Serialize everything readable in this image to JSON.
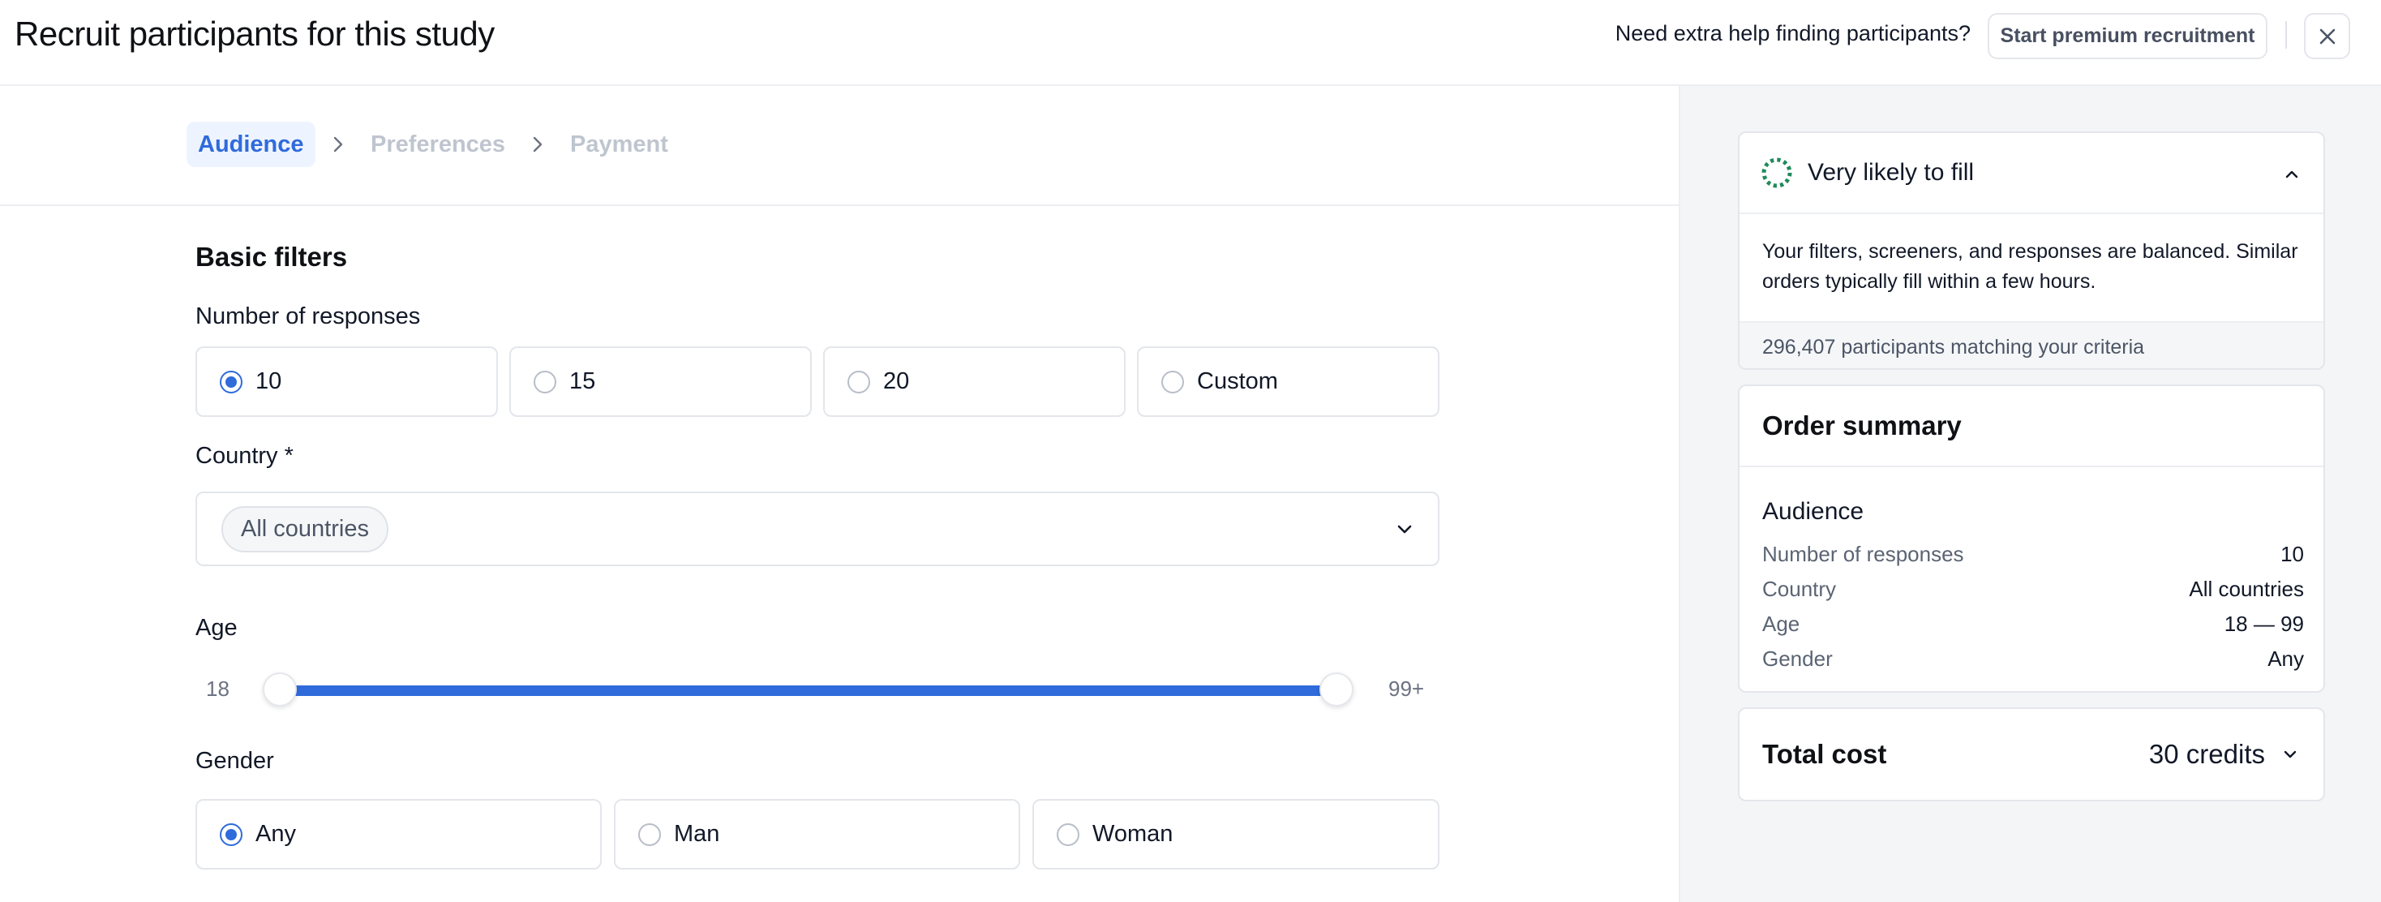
{
  "header": {
    "title": "Recruit participants for this study",
    "help_text": "Need extra help finding participants?",
    "premium_button": "Start premium recruitment"
  },
  "stepper": {
    "steps": [
      {
        "label": "Audience"
      },
      {
        "label": "Preferences"
      },
      {
        "label": "Payment"
      }
    ]
  },
  "filters": {
    "section_title": "Basic filters",
    "responses": {
      "label": "Number of responses",
      "options": [
        "10",
        "15",
        "20",
        "Custom"
      ],
      "selected": "10"
    },
    "country": {
      "label": "Country *",
      "chip": "All countries"
    },
    "age": {
      "label": "Age",
      "min_label": "18",
      "max_label": "99+",
      "range": [
        18,
        99
      ]
    },
    "gender": {
      "label": "Gender",
      "options": [
        "Any",
        "Man",
        "Woman"
      ],
      "selected": "Any"
    }
  },
  "fill_status": {
    "title": "Very likely to fill",
    "description": "Your filters, screeners, and responses are balanced. Similar orders typically fill within a few hours.",
    "match_count": "296,407 participants matching your criteria"
  },
  "summary": {
    "title": "Order summary",
    "section": "Audience",
    "rows": [
      {
        "key": "Number of responses",
        "value": "10"
      },
      {
        "key": "Country",
        "value": "All countries"
      },
      {
        "key": "Age",
        "value": "18 — 99"
      },
      {
        "key": "Gender",
        "value": "Any"
      }
    ]
  },
  "cost": {
    "title": "Total cost",
    "value": "30 credits"
  },
  "colors": {
    "accent": "#2f6bdb",
    "fill_indicator": "#1f8a5b",
    "panel_bg": "#f4f5f7"
  },
  "icons": {
    "close": "close-icon",
    "chevron_right": "chevron-right-icon",
    "chevron_down": "chevron-down-icon",
    "chevron_up": "chevron-up-icon",
    "status": "status-ring-icon"
  }
}
